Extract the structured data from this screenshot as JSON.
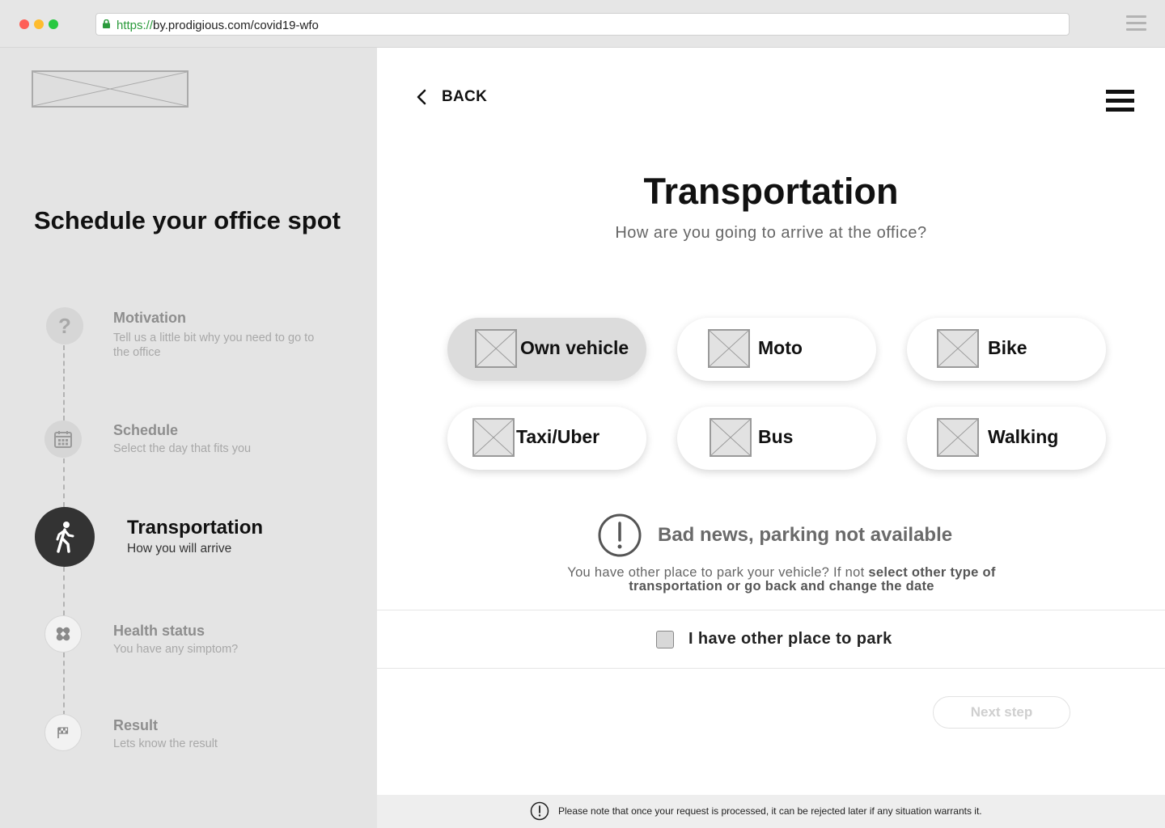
{
  "browser": {
    "url_scheme": "https://",
    "url_rest": "by.prodigious.com/covid19-wfo"
  },
  "sidebar": {
    "title": "Schedule your office spot",
    "steps": [
      {
        "title": "Motivation",
        "subtitle": "Tell us a little bit why you need to go to the office",
        "icon": "question-icon",
        "state": "done"
      },
      {
        "title": "Schedule",
        "subtitle": "Select the day that fits you",
        "icon": "calendar-icon",
        "state": "done"
      },
      {
        "title": "Transportation",
        "subtitle": "How you will arrive",
        "icon": "walking-person-icon",
        "state": "active"
      },
      {
        "title": "Health status",
        "subtitle": "You have any simptom?",
        "icon": "bandage-icon",
        "state": "pending"
      },
      {
        "title": "Result",
        "subtitle": "Lets know the result",
        "icon": "flag-icon",
        "state": "pending"
      }
    ]
  },
  "header": {
    "back_label": "BACK"
  },
  "main": {
    "title": "Transportation",
    "subtitle": "How are you going to arrive at the office?",
    "options": [
      {
        "label": "Own vehicle",
        "selected": true
      },
      {
        "label": "Moto",
        "selected": false
      },
      {
        "label": "Bike",
        "selected": false
      },
      {
        "label": "Taxi/Uber",
        "selected": false
      },
      {
        "label": "Bus",
        "selected": false
      },
      {
        "label": "Walking",
        "selected": false
      }
    ],
    "warning": {
      "title": "Bad news, parking not available",
      "text_plain": "You have other place to park your vehicle? If not ",
      "text_bold": "select other type of transportation or go back and change the date"
    },
    "park_checkbox": {
      "label": "I have other place to park",
      "checked": false
    },
    "next_button": "Next step",
    "footer_note": "Please note that once your request is processed, it can be rejected later if any situation warrants it."
  },
  "colors": {
    "accent_dark": "#333333",
    "selected_option_bg": "#dcdcdc",
    "sidebar_bg": "#e4e4e4"
  }
}
